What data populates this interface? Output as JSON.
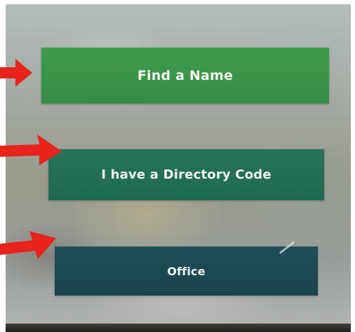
{
  "kiosk": {
    "buttons": {
      "find_name_label": "Find a Name",
      "directory_code_label": "I have a Directory Code",
      "office_label": "Office"
    }
  },
  "annotation": {
    "arrow_color": "#e8231c",
    "arrow_count": 3
  },
  "colors": {
    "find_name_button": "#3a9448",
    "directory_code_button": "#226e55",
    "office_button": "#1c4852"
  }
}
